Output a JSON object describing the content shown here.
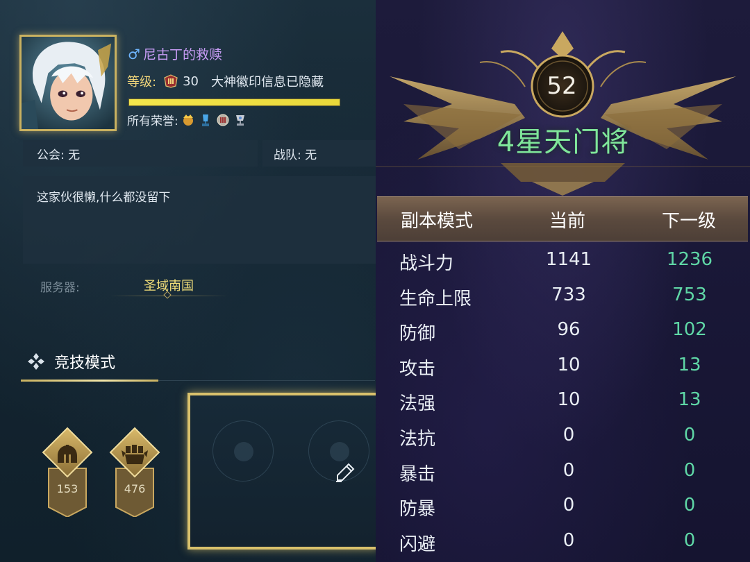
{
  "profile": {
    "gender_symbol": "♂",
    "name": "尼古丁的救赎",
    "level_label": "等级:",
    "level": "30",
    "badge_status": "大神徽印信息已隐藏",
    "exp_fraction": 1.0,
    "honor_label": "所有荣誉:",
    "honor_icons": [
      "gold-crown-icon",
      "blue-trophy-icon",
      "medal-icon",
      "cup-icon"
    ]
  },
  "guild": {
    "label": "公会: 无"
  },
  "team": {
    "label": "战队: 无"
  },
  "bio": {
    "text": "这家伙很懒,什么都没留下"
  },
  "server": {
    "label": "服务器:",
    "value": "圣域南国"
  },
  "section": {
    "title": "竞技模式"
  },
  "medals": [
    {
      "icon": "helmet-badge-icon",
      "value": "153"
    },
    {
      "icon": "fist-badge-icon",
      "value": "476"
    }
  ],
  "rank": {
    "number": "52",
    "title": "4星天门将"
  },
  "table": {
    "headers": [
      "副本模式",
      "当前",
      "下一级"
    ],
    "rows": [
      {
        "name": "战斗力",
        "current": "1141",
        "next": "1236"
      },
      {
        "name": "生命上限",
        "current": "733",
        "next": "753"
      },
      {
        "name": "防御",
        "current": "96",
        "next": "102"
      },
      {
        "name": "攻击",
        "current": "10",
        "next": "13"
      },
      {
        "name": "法强",
        "current": "10",
        "next": "13"
      },
      {
        "name": "法抗",
        "current": "0",
        "next": "0"
      },
      {
        "name": "暴击",
        "current": "0",
        "next": "0"
      },
      {
        "name": "防暴",
        "current": "0",
        "next": "0"
      },
      {
        "name": "闪避",
        "current": "0",
        "next": "0"
      }
    ]
  },
  "colors": {
    "gold": "#d9c16c",
    "rank_green": "#7fe69a",
    "next_green": "#5fd7a6",
    "name_purple": "#c79cf5",
    "exp_yellow": "#f4e64c"
  }
}
